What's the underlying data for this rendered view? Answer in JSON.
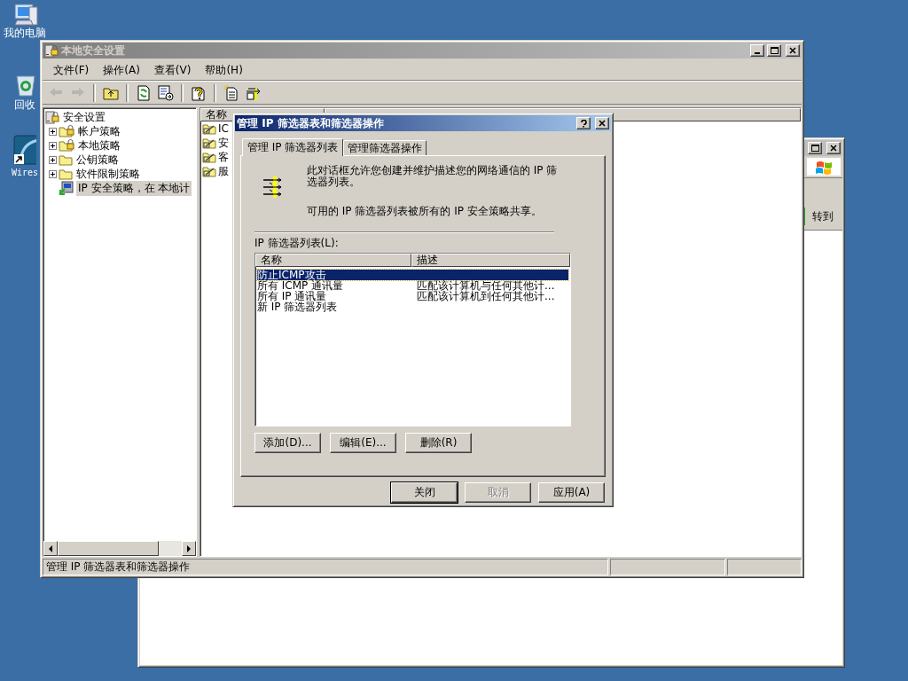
{
  "desktop": {
    "icons": [
      {
        "kind": "computer",
        "label": "我的电脑"
      },
      {
        "kind": "recycle",
        "label": "回收"
      },
      {
        "kind": "shortcut",
        "label": "Wires"
      }
    ]
  },
  "back_window": {
    "active": false,
    "go_button": "转到"
  },
  "main_window": {
    "title": "本地安全设置",
    "active": false,
    "menu": [
      "文件(F)",
      "操作(A)",
      "查看(V)",
      "帮助(H)"
    ],
    "toolbar": [
      {
        "kind": "back",
        "disabled": true
      },
      {
        "kind": "forward",
        "disabled": true
      },
      {
        "kind": "sep"
      },
      {
        "kind": "up",
        "disabled": false
      },
      {
        "kind": "sep"
      },
      {
        "kind": "refresh",
        "disabled": false
      },
      {
        "kind": "export",
        "disabled": false
      },
      {
        "kind": "sep"
      },
      {
        "kind": "help",
        "disabled": false
      },
      {
        "kind": "sep"
      },
      {
        "kind": "new",
        "disabled": false
      },
      {
        "kind": "import",
        "disabled": false
      }
    ],
    "tree": {
      "kind": "root",
      "label": "安全设置",
      "selected": false,
      "children": [
        {
          "kind": "lockfolder",
          "label": "帐户策略",
          "expanded": false,
          "selected": false
        },
        {
          "kind": "lockfolder",
          "label": "本地策略",
          "expanded": false,
          "selected": false
        },
        {
          "kind": "folder",
          "label": "公钥策略",
          "expanded": false,
          "selected": false
        },
        {
          "kind": "folder",
          "label": "软件限制策略",
          "expanded": false,
          "selected": false
        },
        {
          "kind": "ipsec",
          "label": "IP 安全策略，在 本地计",
          "selected": true
        }
      ]
    },
    "list": {
      "columns": [
        "名称"
      ],
      "items": [
        "IC",
        "安",
        "客",
        "服"
      ]
    },
    "status_bar": "管理 IP 筛选器表和筛选器操作"
  },
  "dialog": {
    "title": "管理 IP 筛选器表和筛选器操作",
    "active": true,
    "tabs": [
      {
        "label": "管理 IP 筛选器列表",
        "selected": true
      },
      {
        "label": "管理筛选器操作",
        "selected": false
      }
    ],
    "intro": "此对话框允许您创建并维护描述您的网络通信的 IP 筛选器列表。",
    "note": "可用的 IP 筛选器列表被所有的 IP 安全策略共享。",
    "list_label": "IP 筛选器列表(L):",
    "columns": [
      "名称",
      "描述"
    ],
    "rows": [
      {
        "name": "防止ICMP攻击",
        "description": "",
        "selected": true
      },
      {
        "name": "所有 ICMP 通讯量",
        "description": "匹配该计算机与任何其他计...",
        "selected": false
      },
      {
        "name": "所有 IP 通讯量",
        "description": "匹配该计算机到任何其他计...",
        "selected": false
      },
      {
        "name": "新 IP 筛选器列表",
        "description": "",
        "selected": false
      }
    ],
    "list_buttons": [
      {
        "label": "添加(D)...",
        "disabled": false
      },
      {
        "label": "编辑(E)...",
        "disabled": false
      },
      {
        "label": "删除(R)",
        "disabled": false
      }
    ],
    "footer_buttons": [
      {
        "label": "关闭",
        "disabled": false,
        "default": true
      },
      {
        "label": "取消",
        "disabled": true,
        "default": false
      },
      {
        "label": "应用(A)",
        "disabled": false,
        "default": false
      }
    ]
  }
}
